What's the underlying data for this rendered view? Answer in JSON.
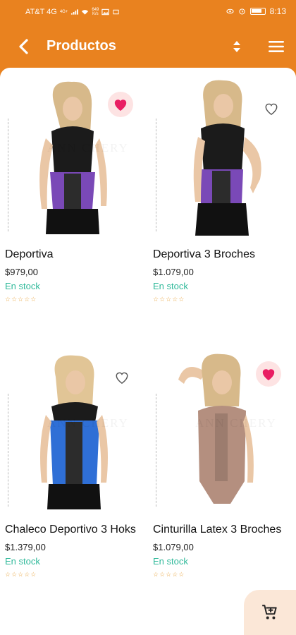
{
  "status_bar": {
    "carrier": "AT&T 4G",
    "signal_label": "4G+",
    "net_speed_top": "649",
    "net_speed_bottom": "K/s",
    "time": "8:13"
  },
  "app_bar": {
    "title": "Productos"
  },
  "products": [
    {
      "name": "Deportiva",
      "price": "$979,00",
      "stock": "En stock",
      "rating": "☆☆☆☆☆",
      "favorite": true
    },
    {
      "name": "Deportiva 3 Broches",
      "price": "$1.079,00",
      "stock": "En stock",
      "rating": "☆☆☆☆☆",
      "favorite": false
    },
    {
      "name": "Chaleco Deportivo 3 Hoks",
      "price": "$1.379,00",
      "stock": "En stock",
      "rating": "☆☆☆☆☆",
      "favorite": false
    },
    {
      "name": "Cinturilla Latex 3 Broches",
      "price": "$1.079,00",
      "stock": "En stock",
      "rating": "☆☆☆☆☆",
      "favorite": true
    }
  ],
  "watermark_text": "ANN CHERY",
  "colors": {
    "primary": "#e9821f",
    "stock": "#2fb99a",
    "favorite": "#e91e63",
    "star": "#e8a33c"
  },
  "icons": {
    "back": "chevron-left-icon",
    "sort": "sort-icon",
    "menu": "hamburger-menu-icon",
    "favorite": "heart-icon",
    "cart": "add-to-cart-icon"
  }
}
